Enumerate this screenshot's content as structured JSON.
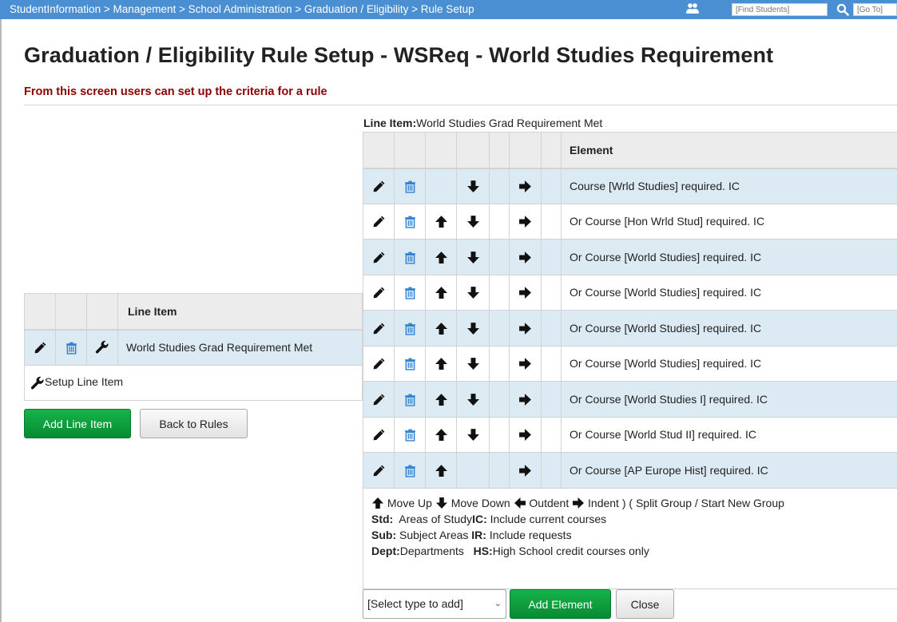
{
  "topbar": {
    "breadcrumb": "StudentInformation > Management > School Administration > Graduation / Eligibility > Rule Setup",
    "find_placeholder": "[Find Students]",
    "goto_placeholder": "[Go To]",
    "bar_color": "#4a8fd1"
  },
  "page": {
    "title": "Graduation / Eligibility Rule Setup - WSReq - World Studies Requirement",
    "subtitle": "From this screen users can set up the criteria for a rule"
  },
  "line_items": {
    "header": "Line Item",
    "rows": [
      {
        "label": "World Studies Grad Requirement Met"
      }
    ],
    "setup_label": "Setup Line Item",
    "add_button": "Add Line Item",
    "back_button": "Back to Rules"
  },
  "elements": {
    "line_item_prefix": "Line Item:",
    "line_item_name": "World Studies Grad Requirement Met",
    "header": "Element",
    "rows": [
      {
        "text": "Course [Wrld Studies] required. IC"
      },
      {
        "text": "Or Course [Hon Wrld Stud] required. IC"
      },
      {
        "text": "Or Course [World Studies] required. IC"
      },
      {
        "text": "Or Course [World Studies] required. IC"
      },
      {
        "text": "Or Course [World Studies] required. IC"
      },
      {
        "text": "Or Course [World Studies] required. IC"
      },
      {
        "text": "Or Course [World Studies I] required. IC"
      },
      {
        "text": "Or Course [World Stud II] required. IC"
      },
      {
        "text": "Or Course [AP Europe Hist] required. IC"
      }
    ],
    "legend": {
      "move_up": "Move Up",
      "move_down": "Move Down",
      "outdent": "Outdent",
      "indent": "Indent",
      "split": ") ( Split Group / Start New Group",
      "std_key": "Std:",
      "std_val": "Areas of Study",
      "ic_key": "IC:",
      "ic_val": "Include current courses",
      "sub_key": "Sub:",
      "sub_val": "Subject Areas",
      "ir_key": "IR:",
      "ir_val": "Include requests",
      "dept_key": "Dept:",
      "dept_val": "Departments",
      "hs_key": "HS:",
      "hs_val": "High School credit courses only"
    },
    "select_value": "[Select type to add]",
    "add_button": "Add Element",
    "close_button": "Close"
  },
  "colors": {
    "accent_green": "#0a9a3c",
    "row_highlight": "#dceaf4",
    "subtitle": "#8b0000",
    "trash_blue": "#2f80d1"
  },
  "icons": {
    "edit": "pencil-icon",
    "delete": "trash-icon",
    "setup": "wrench-icon",
    "up": "arrow-up-icon",
    "down": "arrow-down-icon",
    "left": "arrow-left-icon",
    "right": "arrow-right-icon"
  }
}
